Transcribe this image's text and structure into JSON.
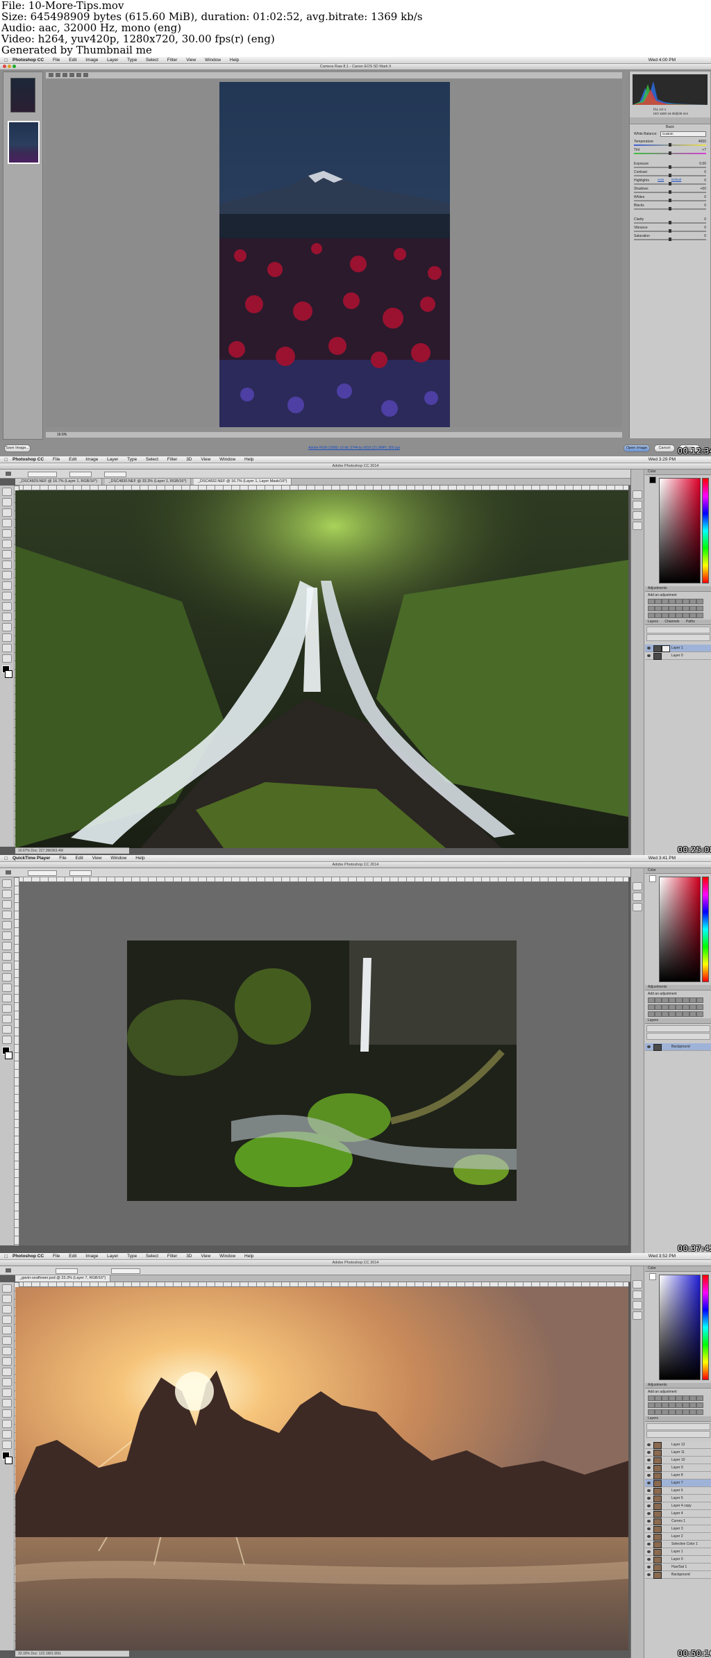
{
  "header": {
    "line1": "File: 10-More-Tips.mov",
    "line2": "Size: 645498909 bytes (615.60 MiB), duration: 01:02:52, avg.bitrate: 1369 kb/s",
    "line3": "Audio: aac, 32000 Hz, mono (eng)",
    "line4": "Video: h264, yuv420p, 1280x720, 30.00 fps(r) (eng)",
    "line5": "Generated by Thumbnail me"
  },
  "frames": [
    {
      "app": "Photoshop CC",
      "menu": [
        "File",
        "Edit",
        "Image",
        "Layer",
        "Type",
        "Select",
        "Filter",
        "View",
        "Window",
        "Help"
      ],
      "window_title": "Camera Raw 8.1 - Canon EOS 5D Mark II",
      "clock": "Wed 4:00 PM",
      "timecode": "00:12:34",
      "buttons": {
        "save": "Save Image...",
        "open": "Open Image",
        "cancel": "Cancel",
        "done": "Done"
      },
      "workflow_link": "Adobe RGB (1998); 16 bit; 3744 by 5616 (21.0MP); 300 ppi",
      "zoom": "16.5%",
      "panel_tab": "Basic",
      "wb_label": "White Balance:",
      "wb_value": "Custom",
      "auto": "Auto",
      "default": "Default",
      "sliders": [
        {
          "label": "Temperature",
          "value": "4650"
        },
        {
          "label": "Tint",
          "value": "+7"
        },
        {
          "label": "Exposure",
          "value": "0.00"
        },
        {
          "label": "Contrast",
          "value": "0"
        },
        {
          "label": "Highlights",
          "value": "0"
        },
        {
          "label": "Shadows",
          "value": "+50"
        },
        {
          "label": "Whites",
          "value": "0"
        },
        {
          "label": "Blacks",
          "value": "0"
        },
        {
          "label": "Clarity",
          "value": "0"
        },
        {
          "label": "Vibrance",
          "value": "0"
        },
        {
          "label": "Saturation",
          "value": "0"
        }
      ],
      "readout": {
        "f": "f/11 1/4 s",
        "iso": "ISO 1600  16-35@35 mm"
      }
    },
    {
      "app": "Photoshop CC",
      "menu": [
        "File",
        "Edit",
        "Image",
        "Layer",
        "Type",
        "Select",
        "Filter",
        "3D",
        "View",
        "Window",
        "Help"
      ],
      "title": "Adobe Photoshop CC 2014",
      "clock": "Wed 3:29 PM",
      "timecode": "00:25:08",
      "tabs": [
        "_DSC4829.NEF @ 16.7% (Layer 1, RGB/16*)",
        "_DSC4830.NEF @ 33.3% (Layer 1, RGB/16*)",
        "_DSC4832.NEF @ 16.7% (Layer 1, Layer Mask/16*)"
      ],
      "status": "16.67%   Doc: 227.3M/363.4M",
      "panels": {
        "color": "Color",
        "swatches": "Swatches",
        "adjustments": "Adjustments",
        "styles": "Styles",
        "add": "Add an adjustment",
        "layers": "Layers",
        "channels": "Channels",
        "paths": "Paths"
      },
      "layers": [
        "Layer 1",
        "Layer 0"
      ]
    },
    {
      "app": "QuickTime Player",
      "menu": [
        "File",
        "Edit",
        "View",
        "Window",
        "Help"
      ],
      "title": "Adobe Photoshop CC 2014",
      "clock": "Wed 3:41 PM",
      "timecode": "00:37:42",
      "layers": [
        "Background"
      ],
      "panels": {
        "color": "Color",
        "swatches": "Swatches",
        "adjustments": "Adjustments",
        "add": "Add an adjustment",
        "layers": "Layers"
      }
    },
    {
      "app": "Photoshop CC",
      "menu": [
        "File",
        "Edit",
        "Image",
        "Layer",
        "Type",
        "Select",
        "Filter",
        "3D",
        "View",
        "Window",
        "Help"
      ],
      "title": "Adobe Photoshop CC 2014",
      "clock": "Wed 3:52 PM",
      "timecode": "00:50:16",
      "tabs": [
        "_gavin-seaflower.psd @ 33.3% (Layer 7, RGB/16*)"
      ],
      "status": "33.33%   Doc: 122.1M/1.90G",
      "layers": [
        "Layer 12",
        "Layer 11",
        "Layer 10",
        "Layer 9",
        "Layer 8",
        "Layer 7",
        "Layer 6",
        "Layer 5",
        "Layer 4 copy",
        "Layer 4",
        "Curves 1",
        "Layer 3",
        "Layer 2",
        "Selective Color 1",
        "Layer 1",
        "Layer 0",
        "Hue/Sat 1",
        "Background"
      ],
      "panels": {
        "color": "Color",
        "swatches": "Swatches",
        "adjustments": "Adjustments",
        "add": "Add an adjustment",
        "layers": "Layers"
      }
    }
  ],
  "colors": {
    "chrome": "#c9c9c9",
    "workspace": "#5a5a5a",
    "selection": "#9fb3d8"
  }
}
